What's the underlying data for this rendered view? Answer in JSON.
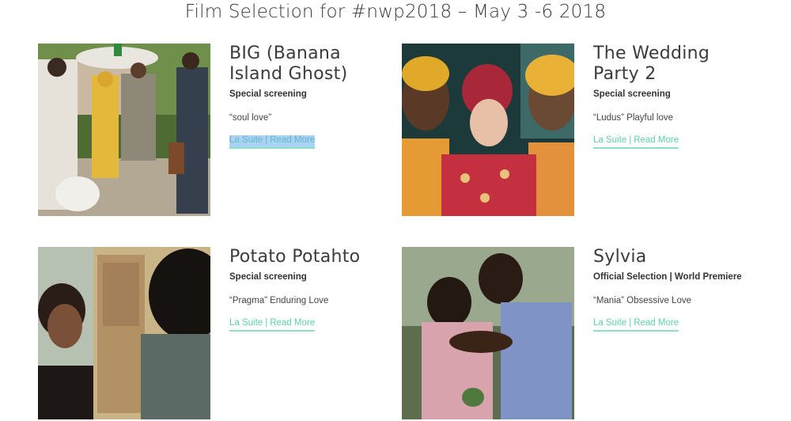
{
  "page": {
    "title": "Film Selection for #nwp2018 – May 3 -6 2018"
  },
  "films": [
    {
      "title_line1": "BIG (Banana",
      "title_line2": "Island Ghost)",
      "category": "Special screening",
      "tagline": "“soul love”",
      "venue_link": "La Suite",
      "separator": "|",
      "read_more": "Read More"
    },
    {
      "title_line1": "The Wedding",
      "title_line2": "Party 2",
      "category": "Special screening",
      "tagline": "“Ludus” Playful love",
      "venue_link": "La Suite",
      "separator": "|",
      "read_more": "Read More"
    },
    {
      "title_line1": "Potato Potahto",
      "category": "Special screening",
      "tagline": "“Pragma” Enduring Love",
      "venue_link": "La Suite",
      "separator": "|",
      "read_more": "Read More"
    },
    {
      "title_line1": "Sylvia",
      "category": "Official Selection | World Premiere",
      "tagline": "“Mania” Obsessive Love",
      "venue_link": "La Suite",
      "separator": "|",
      "read_more": "Read More"
    }
  ],
  "colors": {
    "link_accent": "#5fcfa8",
    "text_selection": "#a9d3f5"
  }
}
